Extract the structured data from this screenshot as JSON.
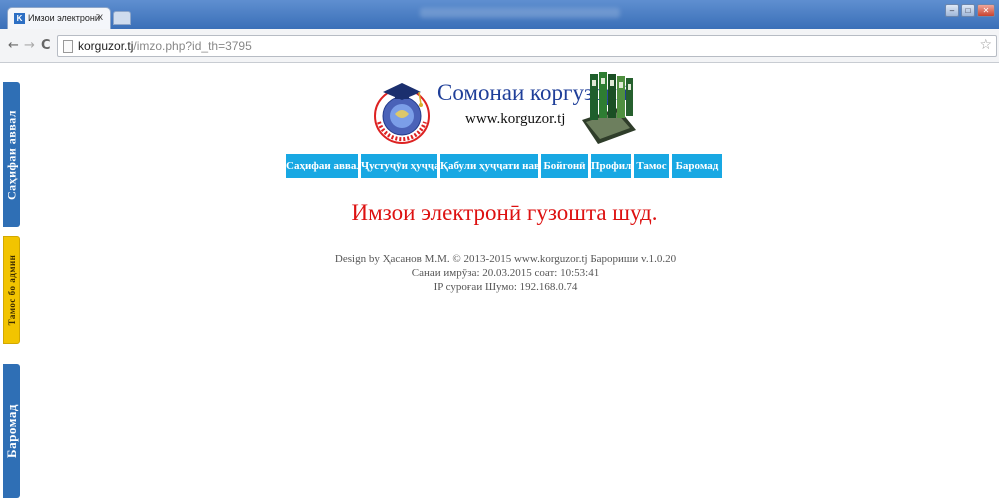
{
  "browser": {
    "tab_title": "Имзои электронӣ",
    "tab_close": "x",
    "url_host": "korguzor.tj",
    "url_path": "/imzo.php?id_th=3795"
  },
  "icons": {
    "back": "back-arrow-icon",
    "forward": "forward-arrow-icon",
    "reload": "reload-icon",
    "page": "page-icon",
    "bookmark": "star-icon"
  },
  "side_tabs": [
    {
      "label": "Саҳифаи аввал",
      "color": "#2f6fb5"
    },
    {
      "label": "Тамос бо админ",
      "color": "#f2c400"
    },
    {
      "label": "Баромад",
      "color": "#2f6fb5"
    }
  ],
  "header": {
    "title": "Сомонаи коргузорӣ",
    "url": "www.korguzor.tj"
  },
  "menu": [
    {
      "label": "Саҳифаи аввал"
    },
    {
      "label": "Ҷустуҷӯи ҳуҷҷат"
    },
    {
      "label": "Қабули ҳуҷҷати нав"
    },
    {
      "label": "Бойгонӣ"
    },
    {
      "label": "Профил"
    },
    {
      "label": "Тамос"
    },
    {
      "label": "Баромад"
    }
  ],
  "menu_color": "#18a8e3",
  "message": "Имзои электронӣ гузошта шуд.",
  "message_color": "#dd1111",
  "footer": {
    "line1": "Design by Ҳасанов М.М. © 2013-2015 www.korguzor.tj Барориши v.1.0.20",
    "line2": "Санаи имрӯза: 20.03.2015 соат: 10:53:41",
    "line3": "IP суроғаи Шумо: 192.168.0.74"
  }
}
